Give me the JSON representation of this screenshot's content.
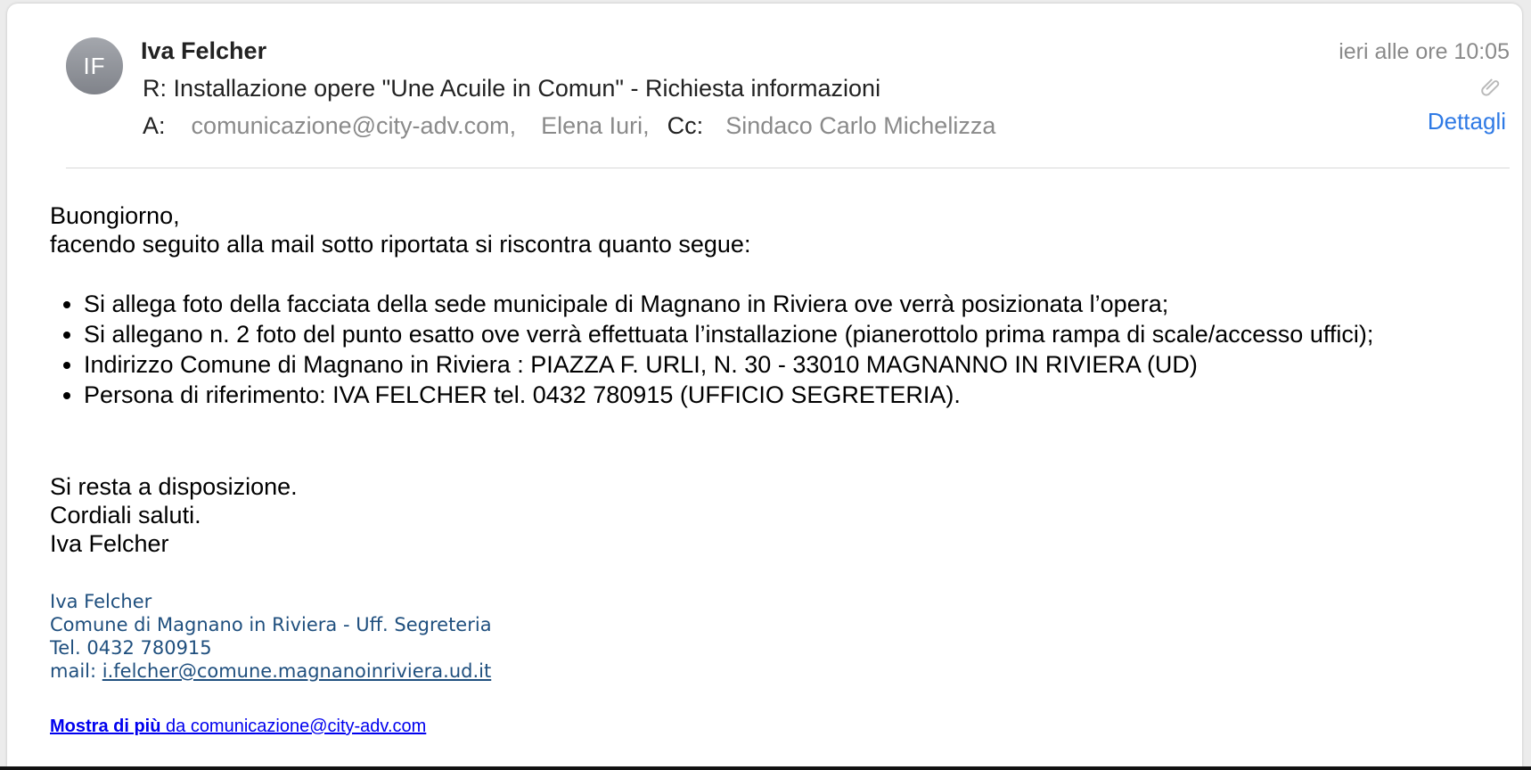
{
  "header": {
    "avatar_initials": "IF",
    "sender": "Iva Felcher",
    "subject": "R: Installazione opere \"Une Acuile in Comun\" - Richiesta informazioni",
    "to_label": "A:",
    "to_recipients": [
      "comunicazione@city-adv.com,",
      "Elena Iuri,"
    ],
    "cc_label": "Cc:",
    "cc_recipients": [
      "Sindaco Carlo Michelizza"
    ],
    "date": "ieri alle ore 10:05",
    "details_label": "Dettagli",
    "attachment_icon": "paperclip-icon"
  },
  "body": {
    "greeting": "Buongiorno,",
    "intro": "facendo seguito alla mail sotto riportata si riscontra quanto segue:",
    "bullets": [
      "Si allega foto della facciata della sede municipale di Magnano in Riviera ove verrà posizionata l’opera;",
      "Si allegano n. 2 foto del punto esatto ove verrà effettuata l’installazione (pianerottolo prima rampa di scale/accesso uffici);",
      "Indirizzo Comune di Magnano in Riviera : PIAZZA F. URLI,  N. 30 - 33010 MAGNANNO IN RIVIERA (UD)",
      "Persona di riferimento:  IVA FELCHER tel. 0432 780915 (UFFICIO SEGRETERIA)."
    ],
    "closing": [
      "Si resta a disposizione.",
      "Cordiali saluti.",
      "Iva Felcher"
    ]
  },
  "signature": {
    "name": "Iva Felcher",
    "office": "Comune di Magnano in Riviera - Uff. Segreteria",
    "tel": "Tel.  0432 780915",
    "mail_label": "mail: ",
    "mail_link": "i.felcher@comune.magnanoinriviera.ud.it"
  },
  "footer": {
    "show_more_bold": "Mostra di più",
    "show_more_rest": " da comunicazione@city-adv.com"
  },
  "colors": {
    "link_blue": "#2f7ae5",
    "signature_blue": "#1f4f7e",
    "meta_gray": "#8a8a8a"
  }
}
